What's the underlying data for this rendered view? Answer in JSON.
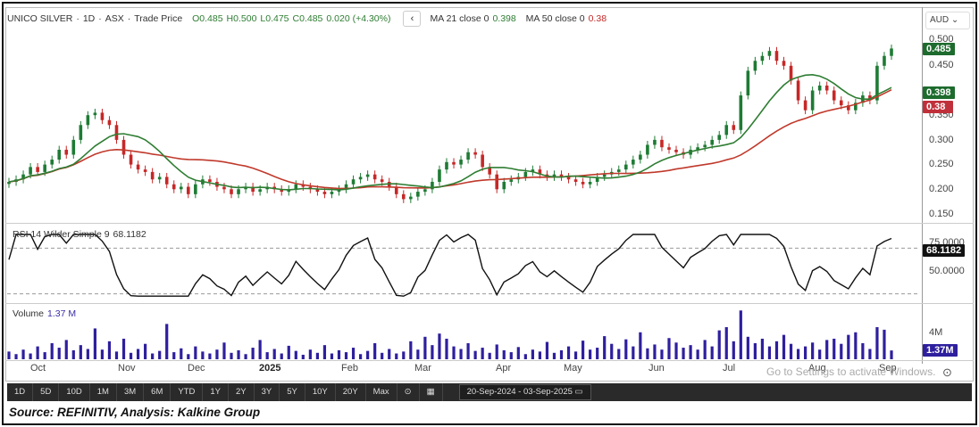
{
  "legend": {
    "symbol": "UNICO SILVER",
    "interval": "1D",
    "exchange": "ASX",
    "price_type": "Trade Price",
    "open": "O0.485",
    "high": "H0.500",
    "low": "L0.475",
    "close": "C0.485",
    "change": "0.020 (+4.30%)",
    "ma21_label": "MA 21 close 0",
    "ma21_value": "0.398",
    "ma50_label": "MA 50 close 0",
    "ma50_value": "0.38",
    "collapse_icon": "‹"
  },
  "currency": "AUD ⌄",
  "price_axis": [
    "0.500",
    "0.450",
    "0.350",
    "0.300",
    "0.250",
    "0.200",
    "0.150"
  ],
  "tags": {
    "last": "0.485",
    "ma21": "0.398",
    "ma50": "0.38",
    "rsi": "68.1182",
    "volume": "1.37M"
  },
  "rsi": {
    "label": "RSI 14 Wilder Simple 9",
    "value": "68.1182",
    "axis": [
      "75.0000",
      "50.0000"
    ]
  },
  "volume": {
    "label": "Volume",
    "value": "1.37 M",
    "axis": "4M"
  },
  "months": [
    {
      "l": "Oct",
      "bold": false
    },
    {
      "l": "Nov",
      "bold": false
    },
    {
      "l": "Dec",
      "bold": false
    },
    {
      "l": "2025",
      "bold": true
    },
    {
      "l": "Feb",
      "bold": false
    },
    {
      "l": "Mar",
      "bold": false
    },
    {
      "l": "Apr",
      "bold": false
    },
    {
      "l": "May",
      "bold": false
    },
    {
      "l": "Jun",
      "bold": false
    },
    {
      "l": "Jul",
      "bold": false
    },
    {
      "l": "Aug",
      "bold": false
    },
    {
      "l": "Sep",
      "bold": false
    }
  ],
  "watermark": "Go to Settings to activate Windows.",
  "toolbar": {
    "ranges": [
      "1D",
      "5D",
      "10D",
      "1M",
      "3M",
      "6M",
      "YTD",
      "1Y",
      "2Y",
      "3Y",
      "5Y",
      "10Y",
      "20Y",
      "Max"
    ],
    "date_range": "20-Sep-2024 - 03-Sep-2025"
  },
  "source": "Source: REFINITIV, Analysis: Kalkine Group",
  "colors": {
    "up": "#1e7b34",
    "down": "#c62828",
    "ma21": "#2e7d32",
    "ma50": "#c0392b",
    "volume": "#2e1f9e"
  },
  "chart_data": {
    "type": "candlestick",
    "price_range": [
      0.15,
      0.5
    ],
    "closes": [
      0.215,
      0.22,
      0.23,
      0.245,
      0.235,
      0.25,
      0.26,
      0.28,
      0.27,
      0.3,
      0.33,
      0.35,
      0.355,
      0.34,
      0.33,
      0.3,
      0.27,
      0.25,
      0.24,
      0.235,
      0.22,
      0.225,
      0.21,
      0.2,
      0.205,
      0.19,
      0.21,
      0.22,
      0.215,
      0.205,
      0.2,
      0.19,
      0.2,
      0.205,
      0.195,
      0.2,
      0.205,
      0.2,
      0.195,
      0.2,
      0.21,
      0.205,
      0.2,
      0.195,
      0.19,
      0.195,
      0.2,
      0.21,
      0.22,
      0.225,
      0.23,
      0.22,
      0.215,
      0.205,
      0.19,
      0.18,
      0.185,
      0.195,
      0.2,
      0.215,
      0.24,
      0.255,
      0.25,
      0.26,
      0.275,
      0.27,
      0.245,
      0.23,
      0.2,
      0.215,
      0.22,
      0.225,
      0.235,
      0.24,
      0.23,
      0.225,
      0.23,
      0.225,
      0.22,
      0.215,
      0.21,
      0.215,
      0.225,
      0.23,
      0.235,
      0.24,
      0.25,
      0.26,
      0.27,
      0.29,
      0.3,
      0.285,
      0.28,
      0.275,
      0.27,
      0.28,
      0.285,
      0.29,
      0.3,
      0.31,
      0.33,
      0.32,
      0.39,
      0.44,
      0.46,
      0.47,
      0.48,
      0.46,
      0.45,
      0.42,
      0.38,
      0.36,
      0.4,
      0.41,
      0.4,
      0.38,
      0.37,
      0.36,
      0.375,
      0.39,
      0.38,
      0.45,
      0.47,
      0.485
    ],
    "volumes_m": [
      1.2,
      0.8,
      1.5,
      0.9,
      2.0,
      1.1,
      2.5,
      1.8,
      3.0,
      1.4,
      2.2,
      1.6,
      4.8,
      1.5,
      2.8,
      1.2,
      3.2,
      1.0,
      1.6,
      2.4,
      0.9,
      1.3,
      5.5,
      1.1,
      1.7,
      0.8,
      2.0,
      1.2,
      0.9,
      1.5,
      2.6,
      1.0,
      1.4,
      0.8,
      1.8,
      3.0,
      1.1,
      1.6,
      0.9,
      2.1,
      1.3,
      0.7,
      1.5,
      1.0,
      2.2,
      0.9,
      1.4,
      1.1,
      1.8,
      0.8,
      1.3,
      2.5,
      1.0,
      1.6,
      0.9,
      1.2,
      2.8,
      1.5,
      3.5,
      2.2,
      4.0,
      3.2,
      2.0,
      1.6,
      2.5,
      1.3,
      1.8,
      1.0,
      2.3,
      1.4,
      1.1,
      1.9,
      0.8,
      1.5,
      1.2,
      2.7,
      1.0,
      1.4,
      2.0,
      1.2,
      2.9,
      1.5,
      1.8,
      3.6,
      2.4,
      1.6,
      3.1,
      2.0,
      4.2,
      1.7,
      2.3,
      1.5,
      3.3,
      2.6,
      1.8,
      2.2,
      1.5,
      3.0,
      2.0,
      4.5,
      5.0,
      2.8,
      7.6,
      3.5,
      2.5,
      3.2,
      2.0,
      2.8,
      3.8,
      2.4,
      1.6,
      2.0,
      2.6,
      1.5,
      3.0,
      3.2,
      2.4,
      3.8,
      4.2,
      2.5,
      1.6,
      5.0,
      4.6,
      1.37
    ]
  }
}
